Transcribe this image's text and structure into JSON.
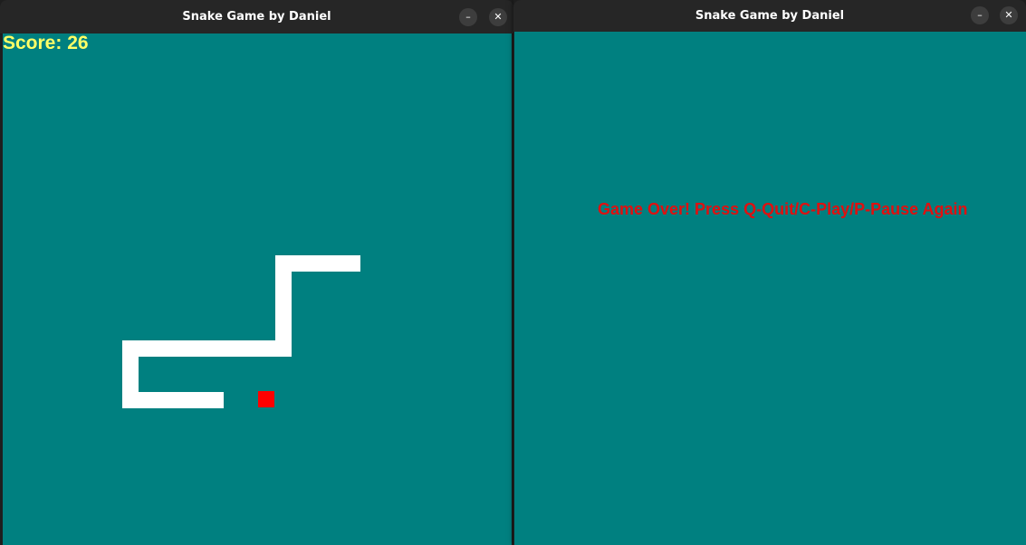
{
  "colors": {
    "background": "#008080",
    "snake": "#ffffff",
    "food": "#ff0000",
    "score_text": "#ffff66",
    "message_text": "#e01010",
    "titlebar": "#262626"
  },
  "windows": [
    {
      "title": "Snake Game by Daniel",
      "minimize_glyph": "–",
      "close_glyph": "✕",
      "score_text": "Score: 26"
    },
    {
      "title": "Snake Game by Daniel",
      "minimize_glyph": "–",
      "close_glyph": "✕",
      "message": "Game Over! Press Q-Quit/C-Play/P-Pause Again"
    }
  ]
}
